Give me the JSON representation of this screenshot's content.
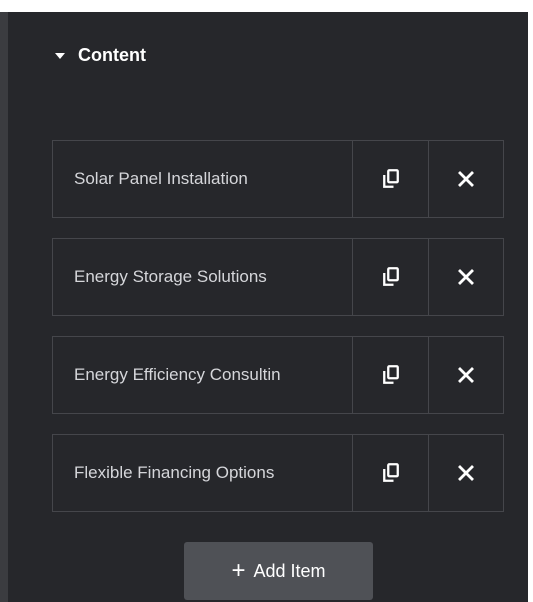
{
  "section": {
    "title": "Content"
  },
  "items": [
    {
      "label": "Solar Panel Installation"
    },
    {
      "label": "Energy Storage Solutions"
    },
    {
      "label": "Energy Efficiency Consultin"
    },
    {
      "label": "Flexible Financing Options"
    }
  ],
  "add_button": {
    "icon": "+",
    "label": "Add Item"
  },
  "icons": {
    "section_toggle": "caret-down-icon",
    "duplicate": "copy-icon",
    "remove": "close-icon"
  },
  "colors": {
    "panel_bg": "#26272b",
    "border": "#45464b",
    "text": "#d5d6da",
    "button_bg": "#4f5156"
  }
}
